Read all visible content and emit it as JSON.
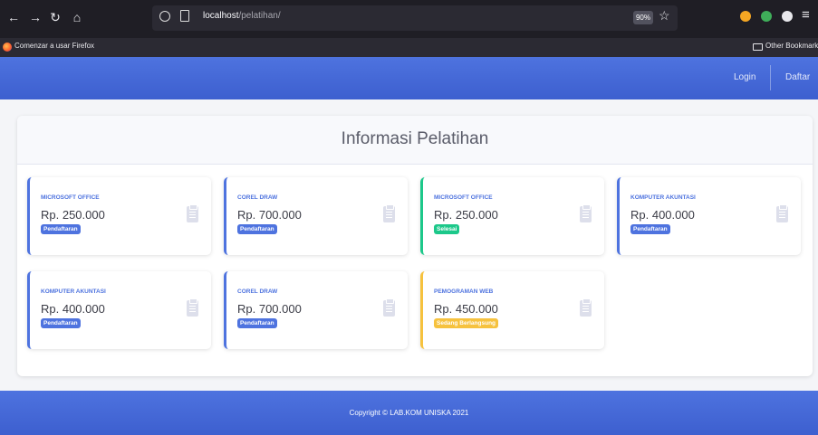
{
  "browser": {
    "url_host": "localhost",
    "url_path": "/pelatihan/",
    "zoom": "90%",
    "bookmark_left": "Comenzar a usar Firefox",
    "bookmark_right": "Other Bookmarks"
  },
  "navbar": {
    "login_label": "Login",
    "register_label": "Daftar"
  },
  "main": {
    "title": "Informasi Pelatihan",
    "cards": [
      {
        "name": "MICROSOFT OFFICE",
        "price": "Rp. 250.000",
        "status": "Pendaftaran",
        "variant": "primary"
      },
      {
        "name": "COREL DRAW",
        "price": "Rp. 700.000",
        "status": "Pendaftaran",
        "variant": "primary"
      },
      {
        "name": "MICROSOFT OFFICE",
        "price": "Rp. 250.000",
        "status": "Selesai",
        "variant": "success"
      },
      {
        "name": "KOMPUTER AKUNTASI",
        "price": "Rp. 400.000",
        "status": "Pendaftaran",
        "variant": "primary"
      },
      {
        "name": "KOMPUTER AKUNTASI",
        "price": "Rp. 400.000",
        "status": "Pendaftaran",
        "variant": "primary"
      },
      {
        "name": "COREL DRAW",
        "price": "Rp. 700.000",
        "status": "Pendaftaran",
        "variant": "primary"
      },
      {
        "name": "PEMOGRAMAN WEB",
        "price": "Rp. 450.000",
        "status": "Sedang Berlangsung",
        "variant": "warning"
      }
    ]
  },
  "footer": {
    "copyright": "Copyright © LAB.KOM UNISKA 2021"
  },
  "colors": {
    "primary": "#4e73df",
    "success": "#1cc88a",
    "warning": "#f6c23e"
  }
}
